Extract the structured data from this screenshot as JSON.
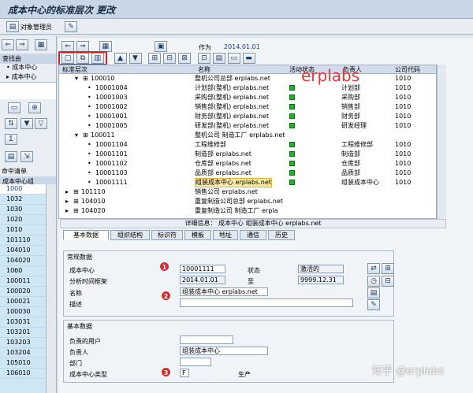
{
  "window": {
    "title": "成本中心的标准层次 更改"
  },
  "app_toolbar": {
    "object_manager": "对象管理员"
  },
  "left": {
    "search_label": "查找由",
    "tree_item1": "成本中心",
    "tree_item2": "成本中心",
    "hit_list": "命中清单",
    "column": "成本中心组",
    "rows": [
      "1000",
      "1032",
      "1030",
      "1020",
      "1010",
      "101110",
      "104010",
      "104020",
      "1060",
      "100011",
      "100020",
      "100021",
      "100030",
      "103031",
      "103201",
      "103203",
      "103204",
      "105010",
      "106010"
    ]
  },
  "toolbar": {
    "as_of_label": "作为",
    "as_of_date": "2014.01.01"
  },
  "tree": {
    "headers": {
      "level": "标准层次",
      "name": "名称",
      "status": "活动状态",
      "owner": "负责人",
      "company": "公司代码"
    },
    "rows": [
      {
        "id": "100010",
        "name": "整机公司总部 erplabs.net",
        "status": false,
        "owner": "",
        "company": "1010",
        "level": 1,
        "node": true
      },
      {
        "id": "10001004",
        "name": "计划部(整机) erplabs.net",
        "status": true,
        "owner": "计划部",
        "company": "1010",
        "level": 2,
        "node": false
      },
      {
        "id": "10001003",
        "name": "采购部(整机) erplabs.net",
        "status": true,
        "owner": "采购部",
        "company": "1010",
        "level": 2,
        "node": false
      },
      {
        "id": "10001002",
        "name": "销售部(整机) erplabs.net",
        "status": true,
        "owner": "销售部",
        "company": "1010",
        "level": 2,
        "node": false
      },
      {
        "id": "10001001",
        "name": "财务部(整机) erplabs.net",
        "status": true,
        "owner": "财务部",
        "company": "1010",
        "level": 2,
        "node": false
      },
      {
        "id": "10001005",
        "name": "研发部(整机) erplabs.net",
        "status": true,
        "owner": "研发经理",
        "company": "1010",
        "level": 2,
        "node": false
      },
      {
        "id": "100011",
        "name": "整机公司 制造工厂 erplabs.net",
        "status": false,
        "owner": "",
        "company": "",
        "level": 1,
        "node": true
      },
      {
        "id": "10001104",
        "name": "工程维修部",
        "status": true,
        "owner": "工程维修部",
        "company": "1010",
        "level": 2,
        "node": false
      },
      {
        "id": "10001101",
        "name": "制造部 erplabs.net",
        "status": true,
        "owner": "制造部",
        "company": "1010",
        "level": 2,
        "node": false
      },
      {
        "id": "10001102",
        "name": "仓库部 erplabs.net",
        "status": true,
        "owner": "仓库部",
        "company": "1010",
        "level": 2,
        "node": false
      },
      {
        "id": "10001103",
        "name": "品质部 erplabs.net",
        "status": true,
        "owner": "品质部",
        "company": "1010",
        "level": 2,
        "node": false
      },
      {
        "id": "10001111",
        "name": "组装成本中心 erplabs.net",
        "status": true,
        "owner": "组装成本中心",
        "company": "1010",
        "level": 2,
        "node": false
      },
      {
        "id": "101110",
        "name": "销售公司 erplabs.net",
        "status": false,
        "owner": "",
        "company": "",
        "level": 0,
        "node": true
      },
      {
        "id": "104010",
        "name": "重复制造公司总部 erplabs.net",
        "status": false,
        "owner": "",
        "company": "",
        "level": 0,
        "node": true
      },
      {
        "id": "104020",
        "name": "重复制造公司 制造工厂 erpla",
        "status": false,
        "owner": "",
        "company": "",
        "level": 0,
        "node": true
      }
    ]
  },
  "watermark": "erplabs",
  "detail": {
    "info": "详细信息： 成本中心 组装成本中心 erplabs.net",
    "tabs": [
      "基本数据",
      "组织结构",
      "标识符",
      "模板",
      "地址",
      "通信",
      "历史"
    ],
    "general_section": "常规数据",
    "cost_center_label": "成本中心",
    "cost_center_value": "10001111",
    "status_label": "状态",
    "status_value": "激活的",
    "period_label": "分析时间框架",
    "period_from": "2014.01.01",
    "to_label": "至",
    "period_to": "9999.12.31",
    "name_label": "名称",
    "name_value": "组装成本中心 erplabs.net",
    "desc_label": "描述",
    "desc_value": "",
    "basic_section": "基本数据",
    "user_label": "负责的用户",
    "user_value": "",
    "owner_label": "负责人",
    "owner_value": "组装成本中心",
    "dept_label": "部门",
    "dept_value": "",
    "type_label": "成本中心类型",
    "type_value": "F",
    "type_text": "生产",
    "badges": [
      "1",
      "2",
      "3"
    ]
  },
  "footer_watermark": "知乎 @erplabs"
}
